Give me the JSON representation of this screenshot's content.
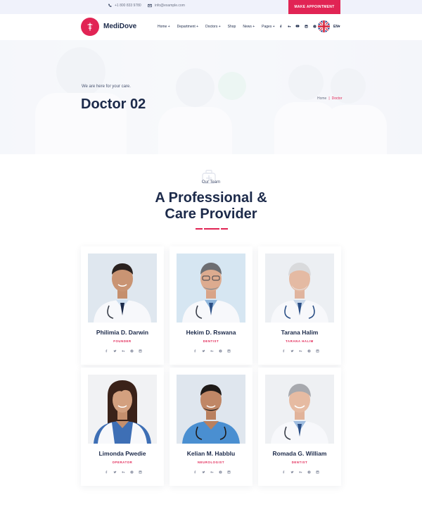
{
  "topbar": {
    "phone": "+1 800 833 9780",
    "email": "info@example.com",
    "appointment_label": "MAKE APPOINTMENT"
  },
  "header": {
    "brand": "MediDove",
    "nav": [
      {
        "label": "Home +"
      },
      {
        "label": "Department +"
      },
      {
        "label": "Doctors +"
      },
      {
        "label": "Shop"
      },
      {
        "label": "News +"
      },
      {
        "label": "Pages +"
      }
    ],
    "social_icons": [
      "facebook-icon",
      "behance-icon",
      "youtube-icon",
      "linkedin-icon",
      "pinterest-icon"
    ],
    "language": "EN▾"
  },
  "hero": {
    "tagline": "We are here for your care.",
    "title": "Doctor 02",
    "breadcrumb": {
      "home": "Home",
      "separator": "|",
      "current": "Doctor"
    }
  },
  "team": {
    "subtitle": "Our Team",
    "title_line1": "A Professional &",
    "title_line2": "Care Provider"
  },
  "doctors": [
    {
      "name": "Philimia D. Darwin",
      "role": "FOUNDER"
    },
    {
      "name": "Hekim D. Rswana",
      "role": "DENTIST"
    },
    {
      "name": "Tarana Halim",
      "role": "TARANA HALIM"
    },
    {
      "name": "Limonda Pwedie",
      "role": "OPERATOR"
    },
    {
      "name": "Kelian M. Habblu",
      "role": "NEUROLOGIST"
    },
    {
      "name": "Romada G. William",
      "role": "DENTIST"
    }
  ],
  "colors": {
    "accent": "#e12454",
    "navy": "#1c2a4a",
    "topbar_bg": "#f0f2fb"
  }
}
